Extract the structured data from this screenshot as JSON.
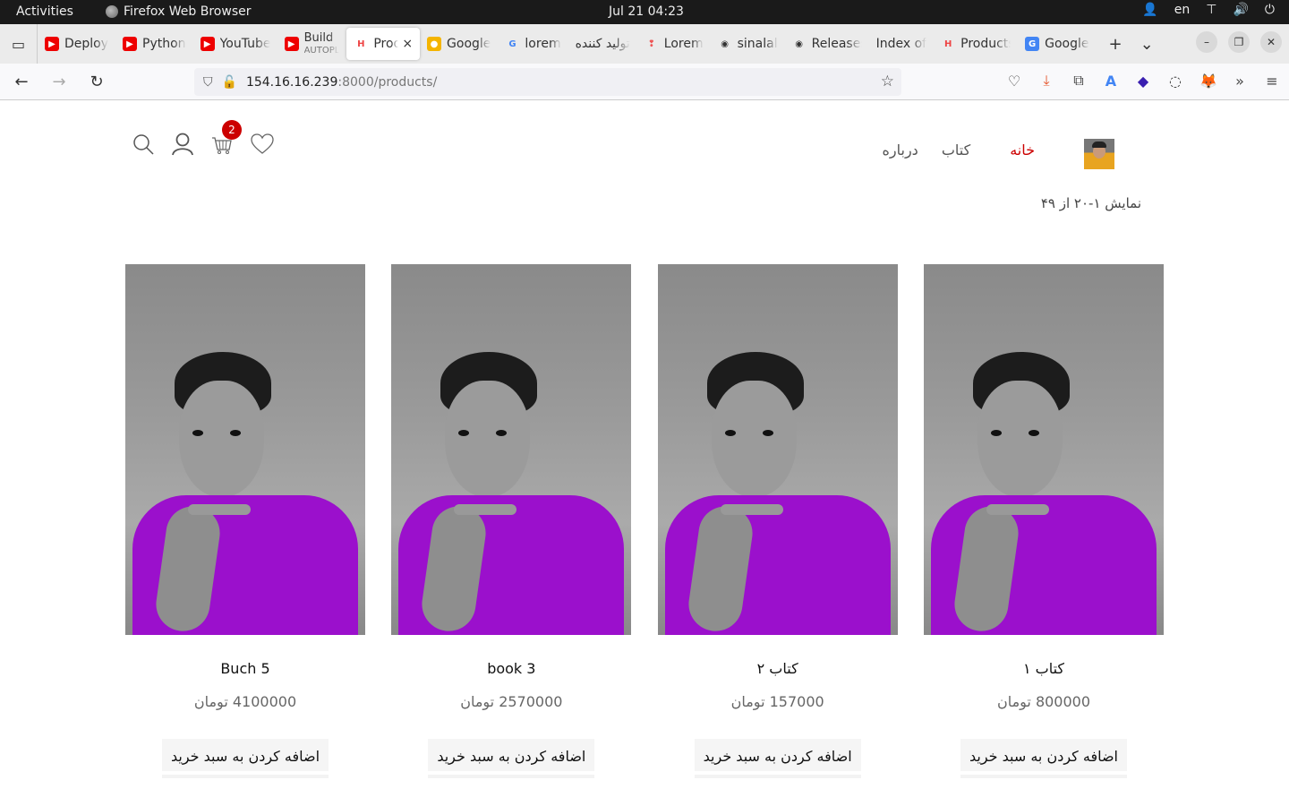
{
  "system": {
    "activities": "Activities",
    "app_name": "Firefox Web Browser",
    "clock": "Jul 21  04:23",
    "lang": "en"
  },
  "tabs": [
    {
      "label": "Deploy",
      "icon": "youtube-icon"
    },
    {
      "label": "Python",
      "icon": "youtube-icon"
    },
    {
      "label": "YouTube",
      "icon": "youtube-icon"
    },
    {
      "label": "Build",
      "sub": "AUTOPL",
      "icon": "youtube-icon"
    },
    {
      "label": "Products",
      "icon": "ht-icon",
      "active": true
    },
    {
      "label": "Google",
      "icon": "google-keep-icon"
    },
    {
      "label": "lorem",
      "icon": "google-icon"
    },
    {
      "label": "تولید کننده",
      "icon": ""
    },
    {
      "label": "Lorem",
      "icon": "lorem-icon"
    },
    {
      "label": "sinalal",
      "icon": "github-icon"
    },
    {
      "label": "Releases",
      "icon": "github-icon"
    },
    {
      "label": "Index of",
      "icon": ""
    },
    {
      "label": "Products",
      "icon": "ht-icon"
    },
    {
      "label": "Google",
      "icon": "google-translate-icon"
    }
  ],
  "url": {
    "host": "154.16.16.239",
    "path": ":8000/products/"
  },
  "header": {
    "cart_count": "2",
    "menu": {
      "home": "خانه",
      "book": "کتاب",
      "about": "درباره"
    }
  },
  "results_count": "نمایش ۱-۲۰ از ۴۹",
  "products": [
    {
      "title": "Buch 5",
      "price": "4100000 تومان",
      "button": "اضافه کردن به سبد خرید"
    },
    {
      "title": "book 3",
      "price": "2570000 تومان",
      "button": "اضافه کردن به سبد خرید"
    },
    {
      "title": "کتاب ۲",
      "price": "157000 تومان",
      "button": "اضافه کردن به سبد خرید"
    },
    {
      "title": "کتاب ۱",
      "price": "800000 تومان",
      "button": "اضافه کردن به سبد خرید"
    }
  ],
  "colors": {
    "accent": "#cc0000",
    "shirt": "#9b10cc"
  }
}
